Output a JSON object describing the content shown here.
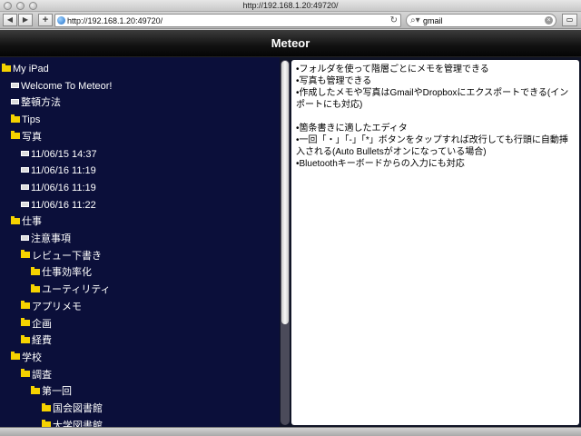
{
  "browser": {
    "window_title": "http://192.168.1.20:49720/",
    "url": "http://192.168.1.20:49720/",
    "search_value": "gmail",
    "back_icon": "◀",
    "forward_icon": "▶",
    "add_icon": "+",
    "reload_icon": "↻",
    "search_glyph": "⌕▾",
    "clear_icon": "×",
    "tabs_icon": "▭"
  },
  "app": {
    "title": "Meteor"
  },
  "tree": [
    {
      "label": "My iPad",
      "type": "folder"
    },
    {
      "label": "Welcome To Meteor!",
      "type": "note"
    },
    {
      "label": "整頓方法",
      "type": "note"
    },
    {
      "label": "Tips",
      "type": "folder"
    },
    {
      "label": "写真",
      "type": "folder"
    },
    {
      "label": "11/06/15 14:37",
      "type": "note"
    },
    {
      "label": "11/06/16 11:19",
      "type": "note"
    },
    {
      "label": "11/06/16 11:19",
      "type": "note"
    },
    {
      "label": "11/06/16 11:22",
      "type": "note"
    },
    {
      "label": "仕事",
      "type": "folder"
    },
    {
      "label": "注意事項",
      "type": "note"
    },
    {
      "label": "レビュー下書き",
      "type": "folder"
    },
    {
      "label": "仕事効率化",
      "type": "folder"
    },
    {
      "label": "ユーティリティ",
      "type": "folder"
    },
    {
      "label": "アプリメモ",
      "type": "folder"
    },
    {
      "label": "企画",
      "type": "folder"
    },
    {
      "label": "経費",
      "type": "folder"
    },
    {
      "label": "学校",
      "type": "folder"
    },
    {
      "label": "調査",
      "type": "folder"
    },
    {
      "label": "第一回",
      "type": "folder"
    },
    {
      "label": "国会図書館",
      "type": "folder"
    },
    {
      "label": "大学図書館",
      "type": "folder"
    }
  ],
  "editor": {
    "lines": [
      "•フォルダを使って階層ごとにメモを管理できる",
      "•写真も管理できる",
      "•作成したメモや写真はGmailやDropboxにエクスポートできる(インポートにも対応)",
      "",
      "•箇条書きに適したエディタ",
      "•一回「・」「-」「*」ボタンをタップすれば改行しても行頭に自動挿入される(Auto Bulletsがオンになっている場合)",
      "•Bluetoothキーボードからの入力にも対応"
    ]
  },
  "colors": {
    "sidebar_bg": "#0b0f3a",
    "folder": "#f5d200",
    "header": "#111111"
  }
}
